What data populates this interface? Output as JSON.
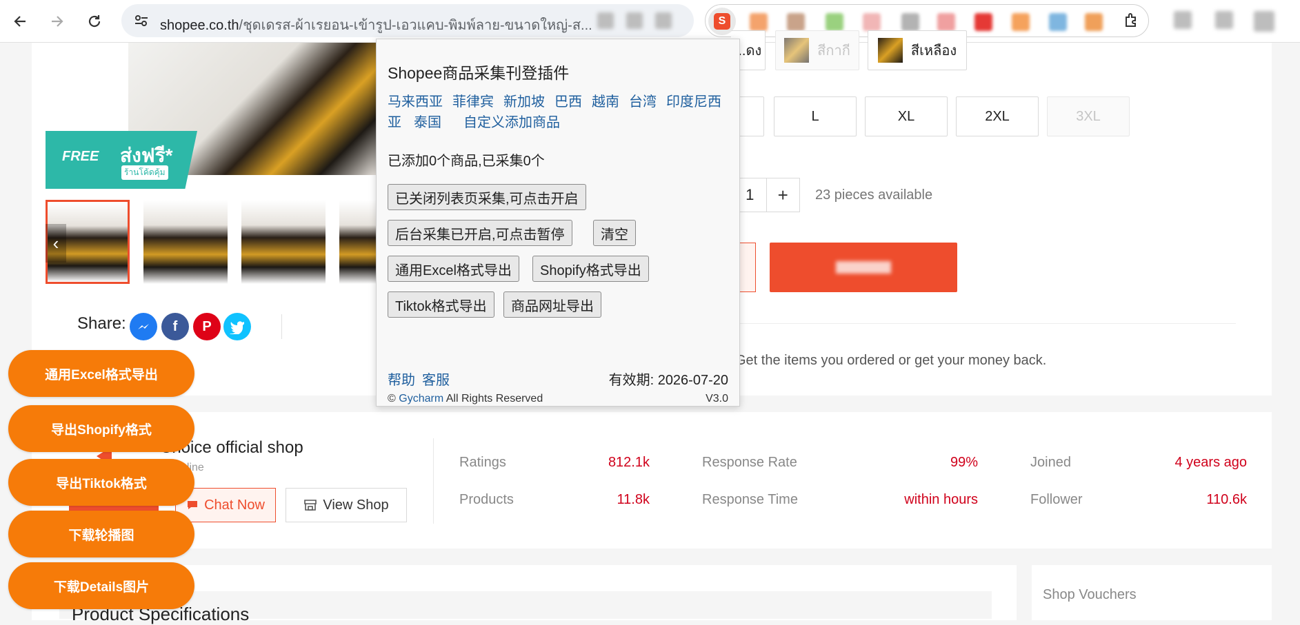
{
  "browser": {
    "url_host": "shopee.co.th",
    "url_path": "/ชุดเดรส-ผ้าเรยอน-เข้ารูป-เอวแคบ-พิมพ์ลาย-ขนาดใหญ่-ส..."
  },
  "product": {
    "free_badge": "FREE",
    "free_text": "ส่งฟรี*",
    "free_sub": "ร้านโค้ดคุ้ม",
    "share_label": "Share:",
    "colors": [
      "...ดง",
      "สีกากี",
      "สีเหลือง"
    ],
    "sizes": [
      "L",
      "XL",
      "2XL",
      "3XL"
    ],
    "quantity": "1",
    "quantity_plus": "+",
    "available": "23 pieces available",
    "guarantee": "Get the items you ordered or get your money back."
  },
  "shop": {
    "name": "Choice official shop",
    "status": "nline",
    "chat_label": "Chat Now",
    "view_label": "View Shop",
    "stats": [
      {
        "label": "Ratings",
        "value": "812.1k"
      },
      {
        "label": "Products",
        "value": "11.8k"
      },
      {
        "label": "Response Rate",
        "value": "99%"
      },
      {
        "label": "Response Time",
        "value": "within hours"
      },
      {
        "label": "Joined",
        "value": "4 years ago"
      },
      {
        "label": "Follower",
        "value": "110.6k"
      }
    ]
  },
  "sections": {
    "spec_title": "Product Specifications",
    "voucher_title": "Shop Vouchers"
  },
  "floating_buttons": [
    "通用Excel格式导出",
    "导出Shopify格式",
    "导出Tiktok格式",
    "下载轮播图",
    "下载Details图片"
  ],
  "popup": {
    "title": "Shopee商品采集刊登插件",
    "countries": [
      "马来西亚",
      "菲律宾",
      "新加坡",
      "巴西",
      "越南",
      "台湾",
      "印度尼西亚",
      "泰国"
    ],
    "custom_add": "自定义添加商品",
    "status": "已添加0个商品,已采集0个",
    "btn_list_collect": "已关闭列表页采集,可点击开启",
    "btn_bg_collect": "后台采集已开启,可点击暂停",
    "btn_clear": "清空",
    "btn_excel": "通用Excel格式导出",
    "btn_shopify": "Shopify格式导出",
    "btn_tiktok": "Tiktok格式导出",
    "btn_url": "商品网址导出",
    "help": "帮助",
    "support": "客服",
    "expiry": "有效期: 2026-07-20",
    "copyright_prefix": "©",
    "copyright_brand": "Gycharm",
    "copyright_suffix": "All Rights Reserved",
    "version": "V3.0"
  },
  "colors": {
    "shopee_orange": "#ee4d2d",
    "float_orange": "#f67b09",
    "link_blue": "#1f5f9e",
    "stat_red": "#d0011b"
  }
}
